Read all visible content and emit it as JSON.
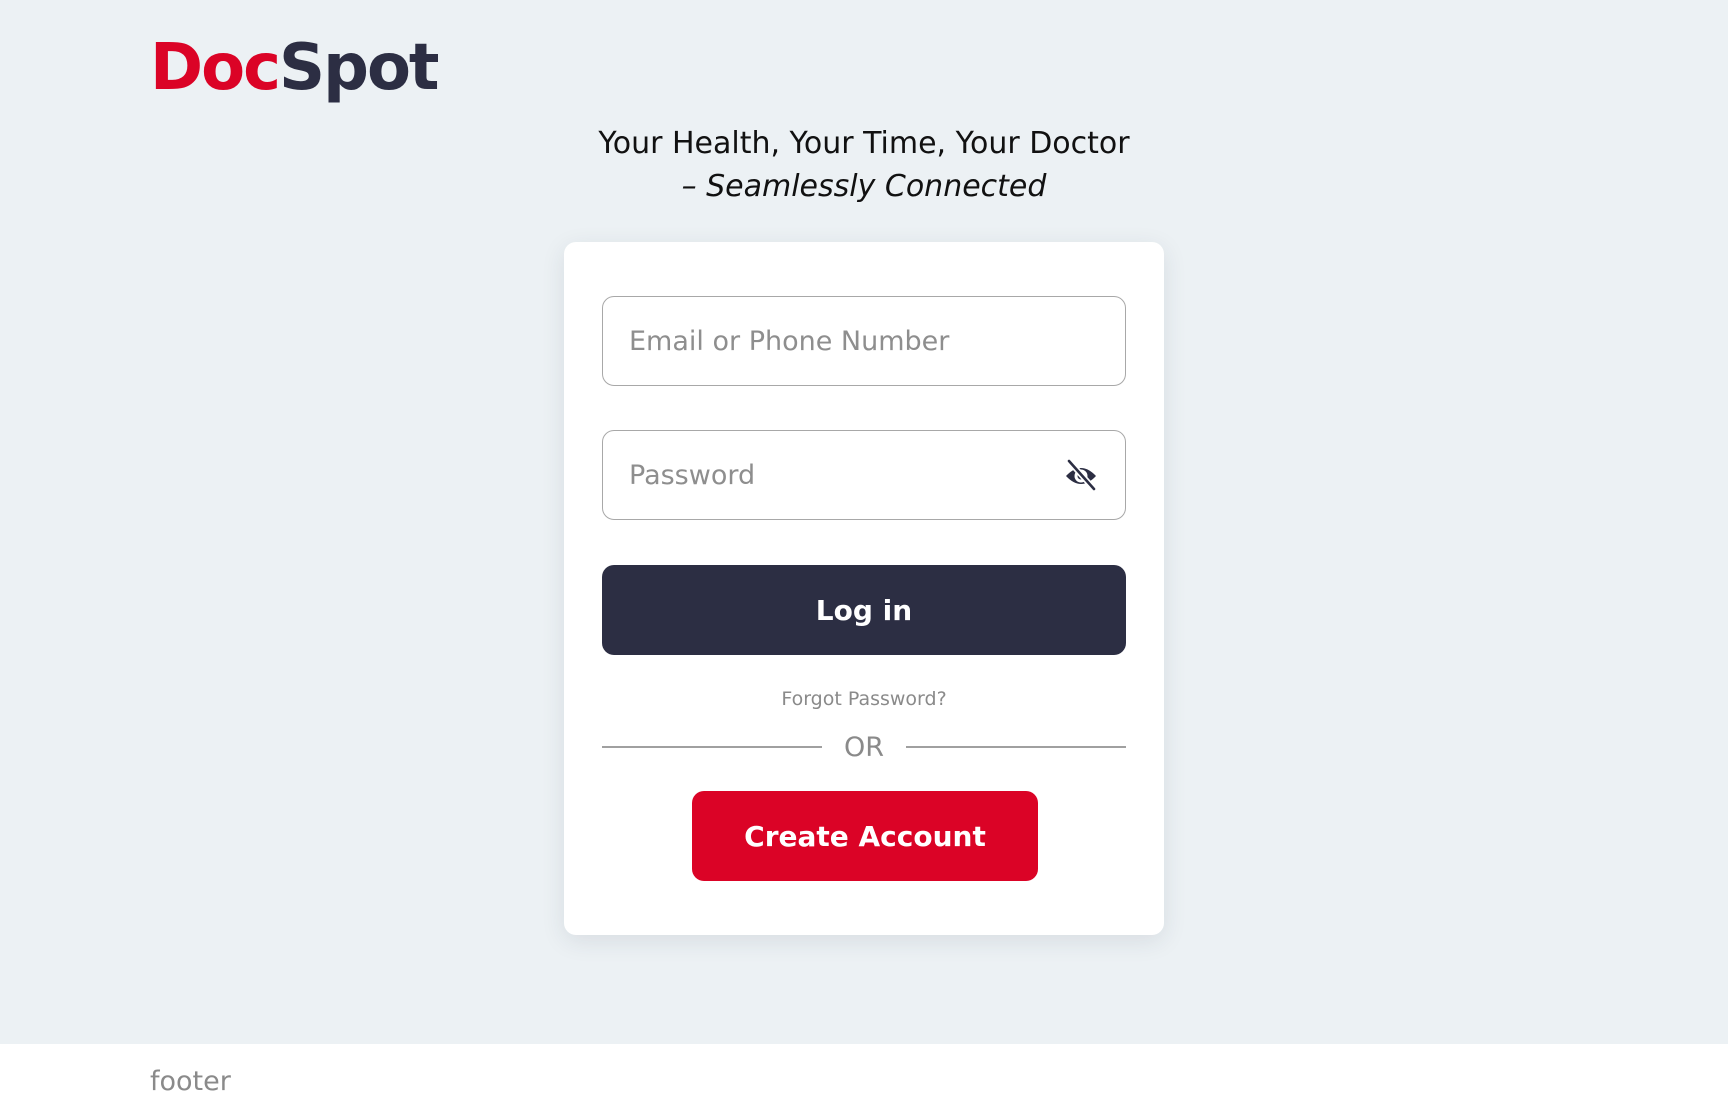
{
  "brand": {
    "part1": "Doc",
    "part2": "Spot",
    "color_primary": "#DB0326",
    "color_dark": "#2C2E43"
  },
  "tagline": {
    "line1": "Your Health, Your Time, Your Doctor",
    "line2": "– Seamlessly Connected"
  },
  "login_form": {
    "email_placeholder": "Email or Phone Number",
    "email_value": "",
    "password_placeholder": "Password",
    "password_value": "",
    "password_toggle_icon": "eye-off-icon",
    "login_label": "Log in",
    "forgot_label": "Forgot Password?",
    "divider_label": "OR",
    "create_label": "Create Account"
  },
  "footer": {
    "text": "footer"
  },
  "colors": {
    "background": "#ECF1F4",
    "card": "#FFFFFF",
    "login_button": "#2C2E43",
    "create_button": "#DB0326"
  }
}
